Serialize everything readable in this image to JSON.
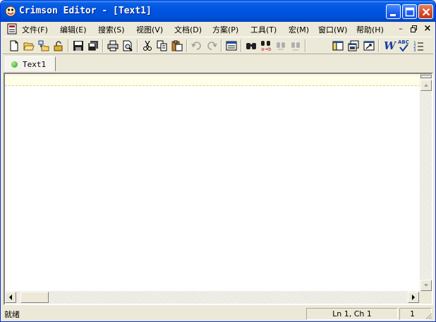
{
  "window": {
    "title": "Crimson Editor - [Text1]"
  },
  "menu": {
    "items": [
      {
        "label": "文件(F)"
      },
      {
        "label": "编辑(E)"
      },
      {
        "label": "搜索(S)"
      },
      {
        "label": "视图(V)"
      },
      {
        "label": "文档(D)"
      },
      {
        "label": "方案(P)"
      },
      {
        "label": "工具(T)"
      },
      {
        "label": "宏(M)"
      },
      {
        "label": "窗口(W)"
      },
      {
        "label": "帮助(H)"
      }
    ],
    "mdi": {
      "minimize": "–",
      "restore": "🗗",
      "close": "×"
    }
  },
  "toolbar": {
    "icons": [
      "new-file-icon",
      "open-folder-icon",
      "open-remote-icon",
      "unlock-icon",
      "save-icon",
      "save-all-icon",
      "print-icon",
      "print-preview-icon",
      "cut-icon",
      "copy-icon",
      "paste-icon",
      "undo-icon",
      "redo-icon",
      "toggle-panel-icon",
      "find-icon",
      "replace-icon",
      "find-next-icon",
      "find-prev-icon",
      "directory-tree-icon",
      "output-window-icon",
      "fullscreen-icon"
    ],
    "word_wrap_label": "W",
    "spell_label": "ABC"
  },
  "tabs": [
    {
      "label": "Text1",
      "status_color": "#2c9c1c"
    }
  ],
  "editor": {
    "content": ""
  },
  "status": {
    "text": "就绪",
    "position": "Ln 1, Ch 1",
    "count": "1"
  },
  "colors": {
    "titlebar": "#0054e3",
    "face": "#ece9d8",
    "ruler": "#ffffe8"
  }
}
